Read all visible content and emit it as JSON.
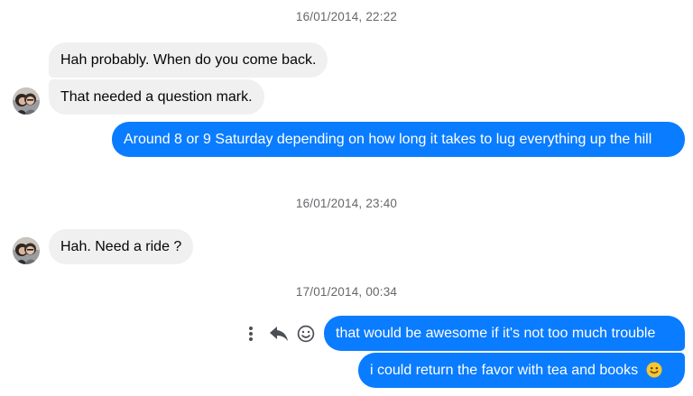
{
  "thread": {
    "timestamps": [
      "16/01/2014, 22:22",
      "16/01/2014, 23:40",
      "17/01/2014, 00:34"
    ],
    "messages": [
      {
        "from": "them",
        "text": "Hah probably. When do you come back."
      },
      {
        "from": "them",
        "text": "That needed a question mark."
      },
      {
        "from": "me",
        "text": "Around 8 or 9 Saturday depending on how long it takes to lug everything up the hill"
      },
      {
        "from": "them",
        "text": "Hah. Need a ride ?"
      },
      {
        "from": "me",
        "text": "that would be awesome if it's not too much trouble"
      },
      {
        "from": "me",
        "text": "i could return the favor with tea and books"
      }
    ],
    "emoji": "🙂"
  },
  "actions": {
    "more": "more-vertical-icon",
    "reply": "reply-icon",
    "react": "smiley-icon"
  },
  "colors": {
    "outgoing_bubble": "#0a7cff",
    "incoming_bubble": "#f0f0f0",
    "timestamp_text": "#65676b"
  }
}
